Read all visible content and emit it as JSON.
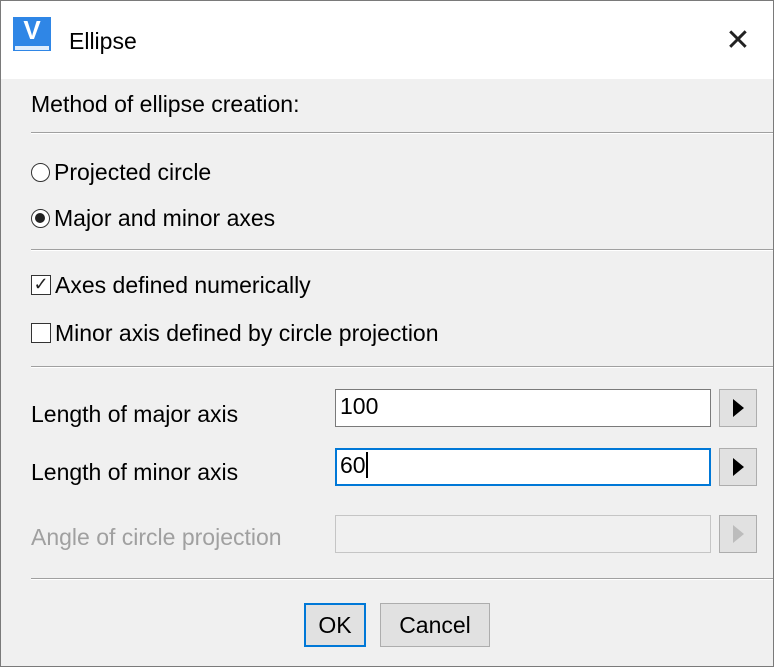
{
  "window": {
    "title": "Ellipse",
    "icon": "vectorcad-app-icon",
    "icon_letter": "V",
    "close_glyph": "✕"
  },
  "method": {
    "heading": "Method of ellipse creation:",
    "options": [
      {
        "label": "Projected circle",
        "checked": false
      },
      {
        "label": "Major and minor axes",
        "checked": true
      }
    ]
  },
  "checks": [
    {
      "label": "Axes defined numerically",
      "checked": true,
      "mark": "✓"
    },
    {
      "label": "Minor axis defined by circle projection",
      "checked": false,
      "mark": ""
    }
  ],
  "fields": [
    {
      "label": "Length of major axis",
      "value": "100",
      "enabled": true,
      "focused": false
    },
    {
      "label": "Length of minor axis",
      "value": "60",
      "enabled": true,
      "focused": true
    },
    {
      "label": "Angle of circle projection",
      "value": "",
      "enabled": false,
      "focused": false
    }
  ],
  "buttons": {
    "ok": "OK",
    "cancel": "Cancel"
  },
  "colors": {
    "accent": "#0078d7",
    "icon_blue": "#2f86e6",
    "disabled_text": "#a0a0a0"
  }
}
